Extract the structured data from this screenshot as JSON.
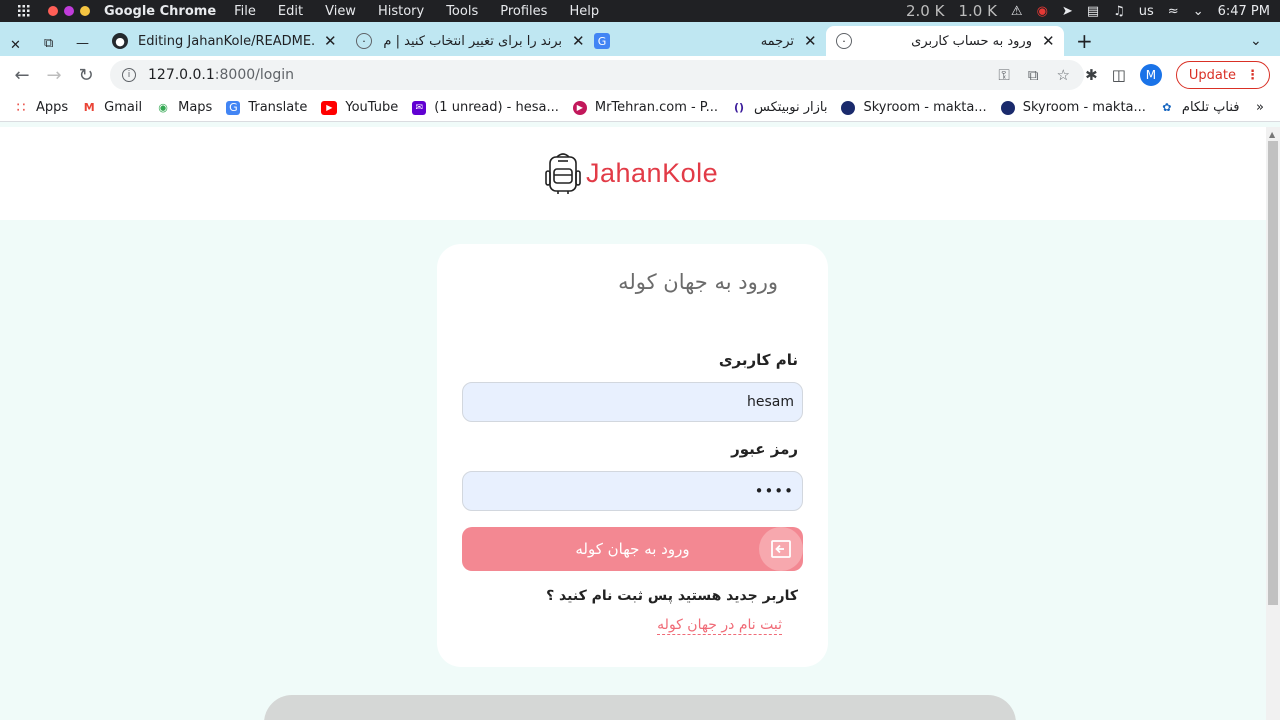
{
  "menubar": {
    "app_name": "Google Chrome",
    "menus": [
      "File",
      "Edit",
      "View",
      "History",
      "Tools",
      "Profiles",
      "Help"
    ],
    "net_down": "2.0 K",
    "net_up": "1.0 K",
    "keyboard": "us",
    "time": "6:47 PM"
  },
  "tabs": [
    {
      "title": "Editing JahanKole/README.m",
      "favicon": "github-icon"
    },
    {
      "title": "برند را برای تغییر انتخاب کنید | م",
      "favicon": "globe-icon"
    },
    {
      "title": "ترجمه",
      "favicon": "google-translate-icon"
    },
    {
      "title": "ورود به حساب کاربری",
      "favicon": "globe-icon"
    }
  ],
  "omnibox": {
    "host": "127.0.0.1",
    "path": ":8000/login"
  },
  "toolbar": {
    "profile_initial": "M",
    "update_label": "Update"
  },
  "bookmarks": [
    {
      "label": "Apps",
      "icon": "apps-grid-icon"
    },
    {
      "label": "Gmail",
      "icon": "gmail-icon"
    },
    {
      "label": "Maps",
      "icon": "maps-icon"
    },
    {
      "label": "Translate",
      "icon": "translate-icon"
    },
    {
      "label": "YouTube",
      "icon": "youtube-icon"
    },
    {
      "label": "(1 unread) - hesa...",
      "icon": "mail-icon"
    },
    {
      "label": "MrTehran.com - P...",
      "icon": "mrtehran-icon"
    },
    {
      "label": "بازار نوبیتکس",
      "icon": "nobitex-icon"
    },
    {
      "label": "Skyroom - makta...",
      "icon": "skyroom-icon"
    },
    {
      "label": "Skyroom - makta...",
      "icon": "skyroom-icon"
    },
    {
      "label": "فناپ تلکام",
      "icon": "fanap-icon"
    }
  ],
  "site": {
    "brand": "JahanKole"
  },
  "login": {
    "title": "ورود به جهان کوله",
    "username_label": "نام کاربری",
    "username_value": "hesam",
    "password_label": "رمز عبور",
    "password_value": "••••",
    "submit_label": "ورود به جهان کوله",
    "signup_question": "کاربر جدید هستید پس ثبت نام کنید ؟",
    "signup_link": "ثبت نام در جهان کوله"
  },
  "colors": {
    "accent": "#e23b47",
    "button": "#f38892",
    "tabstrip": "#bfe7f2"
  }
}
